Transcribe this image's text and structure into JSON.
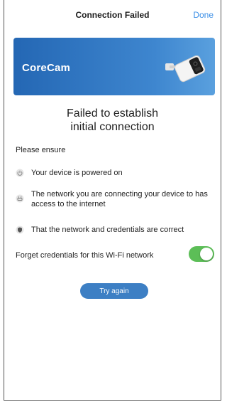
{
  "header": {
    "title": "Connection Failed",
    "done_label": "Done"
  },
  "banner": {
    "brand": "CoreCam",
    "colors": {
      "start": "#2467b4",
      "end": "#5aa0de"
    }
  },
  "message": {
    "line1": "Failed to establish",
    "line2": "initial connection"
  },
  "checklist": {
    "title": "Please ensure",
    "items": [
      {
        "icon": "power-icon",
        "text": "Your device is powered on"
      },
      {
        "icon": "router-icon",
        "text": "The network you are connecting your device to has access to the internet"
      },
      {
        "icon": "shield-icon",
        "text": "That the network and credentials are correct"
      }
    ]
  },
  "forget": {
    "label": "Forget credentials for this Wi-Fi network",
    "enabled": true,
    "color": "#5cbe57"
  },
  "retry": {
    "label": "Try again",
    "color": "#3d7fc4"
  }
}
